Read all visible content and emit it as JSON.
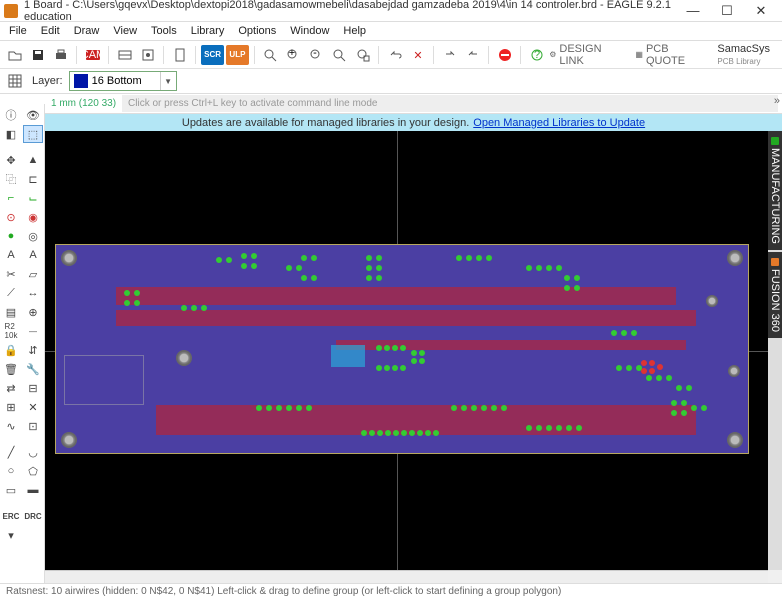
{
  "title": "1 Board - C:\\Users\\gqevx\\Desktop\\dextopi2018\\gadasamowmebeli\\dasabejdad gamzadeba 2019\\4\\in 14 controler.brd - EAGLE 9.2.1 education",
  "menus": [
    "File",
    "Edit",
    "Draw",
    "View",
    "Tools",
    "Library",
    "Options",
    "Window",
    "Help"
  ],
  "layer": {
    "label": "Layer:",
    "selected": "16 Bottom"
  },
  "coord": "1 mm (120 33)",
  "cmdline_placeholder": "Click or press Ctrl+L key to activate command line mode",
  "banner": {
    "text": "Updates are available for managed libraries in your design. ",
    "link": "Open Managed Libraries to Update"
  },
  "vtabs": {
    "a": "MANUFACTURING",
    "b": "FUSION 360"
  },
  "status": "Ratsnest: 10 airwires (hidden: 0 N$42, 0 N$41) Left-click & drag to define group (or left-click to start defining a group polygon)",
  "brand": {
    "design_link": "DESIGN LINK",
    "pcb_quote": "PCB QUOTE",
    "samacsys": "SamacSys",
    "samacsys_sub": "PCB Library"
  },
  "buttons": {
    "scr": "SCR",
    "ulp": "ULP",
    "erc": "ERC",
    "drc": "DRC"
  }
}
